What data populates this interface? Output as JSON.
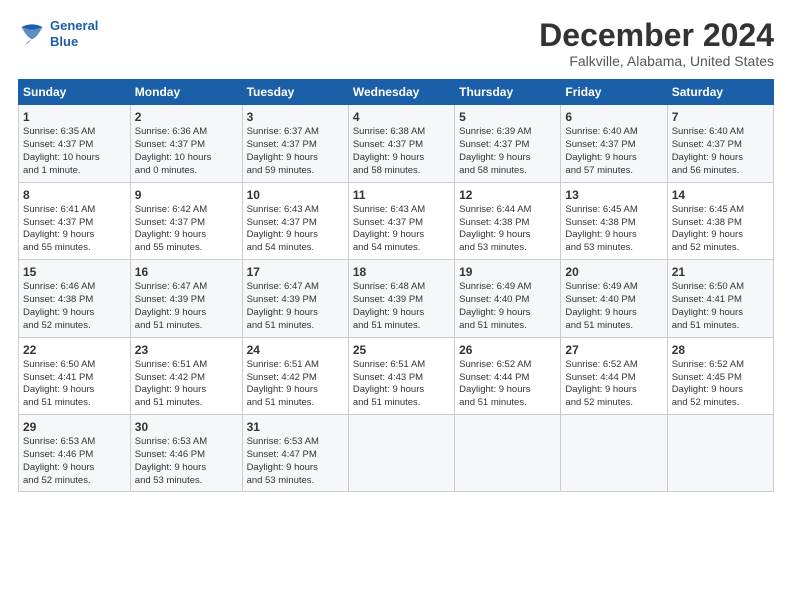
{
  "logo": {
    "line1": "General",
    "line2": "Blue"
  },
  "title": "December 2024",
  "subtitle": "Falkville, Alabama, United States",
  "days_header": [
    "Sunday",
    "Monday",
    "Tuesday",
    "Wednesday",
    "Thursday",
    "Friday",
    "Saturday"
  ],
  "weeks": [
    [
      {
        "day": "1",
        "info": "Sunrise: 6:35 AM\nSunset: 4:37 PM\nDaylight: 10 hours\nand 1 minute."
      },
      {
        "day": "2",
        "info": "Sunrise: 6:36 AM\nSunset: 4:37 PM\nDaylight: 10 hours\nand 0 minutes."
      },
      {
        "day": "3",
        "info": "Sunrise: 6:37 AM\nSunset: 4:37 PM\nDaylight: 9 hours\nand 59 minutes."
      },
      {
        "day": "4",
        "info": "Sunrise: 6:38 AM\nSunset: 4:37 PM\nDaylight: 9 hours\nand 58 minutes."
      },
      {
        "day": "5",
        "info": "Sunrise: 6:39 AM\nSunset: 4:37 PM\nDaylight: 9 hours\nand 58 minutes."
      },
      {
        "day": "6",
        "info": "Sunrise: 6:40 AM\nSunset: 4:37 PM\nDaylight: 9 hours\nand 57 minutes."
      },
      {
        "day": "7",
        "info": "Sunrise: 6:40 AM\nSunset: 4:37 PM\nDaylight: 9 hours\nand 56 minutes."
      }
    ],
    [
      {
        "day": "8",
        "info": "Sunrise: 6:41 AM\nSunset: 4:37 PM\nDaylight: 9 hours\nand 55 minutes."
      },
      {
        "day": "9",
        "info": "Sunrise: 6:42 AM\nSunset: 4:37 PM\nDaylight: 9 hours\nand 55 minutes."
      },
      {
        "day": "10",
        "info": "Sunrise: 6:43 AM\nSunset: 4:37 PM\nDaylight: 9 hours\nand 54 minutes."
      },
      {
        "day": "11",
        "info": "Sunrise: 6:43 AM\nSunset: 4:37 PM\nDaylight: 9 hours\nand 54 minutes."
      },
      {
        "day": "12",
        "info": "Sunrise: 6:44 AM\nSunset: 4:38 PM\nDaylight: 9 hours\nand 53 minutes."
      },
      {
        "day": "13",
        "info": "Sunrise: 6:45 AM\nSunset: 4:38 PM\nDaylight: 9 hours\nand 53 minutes."
      },
      {
        "day": "14",
        "info": "Sunrise: 6:45 AM\nSunset: 4:38 PM\nDaylight: 9 hours\nand 52 minutes."
      }
    ],
    [
      {
        "day": "15",
        "info": "Sunrise: 6:46 AM\nSunset: 4:38 PM\nDaylight: 9 hours\nand 52 minutes."
      },
      {
        "day": "16",
        "info": "Sunrise: 6:47 AM\nSunset: 4:39 PM\nDaylight: 9 hours\nand 51 minutes."
      },
      {
        "day": "17",
        "info": "Sunrise: 6:47 AM\nSunset: 4:39 PM\nDaylight: 9 hours\nand 51 minutes."
      },
      {
        "day": "18",
        "info": "Sunrise: 6:48 AM\nSunset: 4:39 PM\nDaylight: 9 hours\nand 51 minutes."
      },
      {
        "day": "19",
        "info": "Sunrise: 6:49 AM\nSunset: 4:40 PM\nDaylight: 9 hours\nand 51 minutes."
      },
      {
        "day": "20",
        "info": "Sunrise: 6:49 AM\nSunset: 4:40 PM\nDaylight: 9 hours\nand 51 minutes."
      },
      {
        "day": "21",
        "info": "Sunrise: 6:50 AM\nSunset: 4:41 PM\nDaylight: 9 hours\nand 51 minutes."
      }
    ],
    [
      {
        "day": "22",
        "info": "Sunrise: 6:50 AM\nSunset: 4:41 PM\nDaylight: 9 hours\nand 51 minutes."
      },
      {
        "day": "23",
        "info": "Sunrise: 6:51 AM\nSunset: 4:42 PM\nDaylight: 9 hours\nand 51 minutes."
      },
      {
        "day": "24",
        "info": "Sunrise: 6:51 AM\nSunset: 4:42 PM\nDaylight: 9 hours\nand 51 minutes."
      },
      {
        "day": "25",
        "info": "Sunrise: 6:51 AM\nSunset: 4:43 PM\nDaylight: 9 hours\nand 51 minutes."
      },
      {
        "day": "26",
        "info": "Sunrise: 6:52 AM\nSunset: 4:44 PM\nDaylight: 9 hours\nand 51 minutes."
      },
      {
        "day": "27",
        "info": "Sunrise: 6:52 AM\nSunset: 4:44 PM\nDaylight: 9 hours\nand 52 minutes."
      },
      {
        "day": "28",
        "info": "Sunrise: 6:52 AM\nSunset: 4:45 PM\nDaylight: 9 hours\nand 52 minutes."
      }
    ],
    [
      {
        "day": "29",
        "info": "Sunrise: 6:53 AM\nSunset: 4:46 PM\nDaylight: 9 hours\nand 52 minutes."
      },
      {
        "day": "30",
        "info": "Sunrise: 6:53 AM\nSunset: 4:46 PM\nDaylight: 9 hours\nand 53 minutes."
      },
      {
        "day": "31",
        "info": "Sunrise: 6:53 AM\nSunset: 4:47 PM\nDaylight: 9 hours\nand 53 minutes."
      },
      {
        "day": "",
        "info": ""
      },
      {
        "day": "",
        "info": ""
      },
      {
        "day": "",
        "info": ""
      },
      {
        "day": "",
        "info": ""
      }
    ]
  ]
}
